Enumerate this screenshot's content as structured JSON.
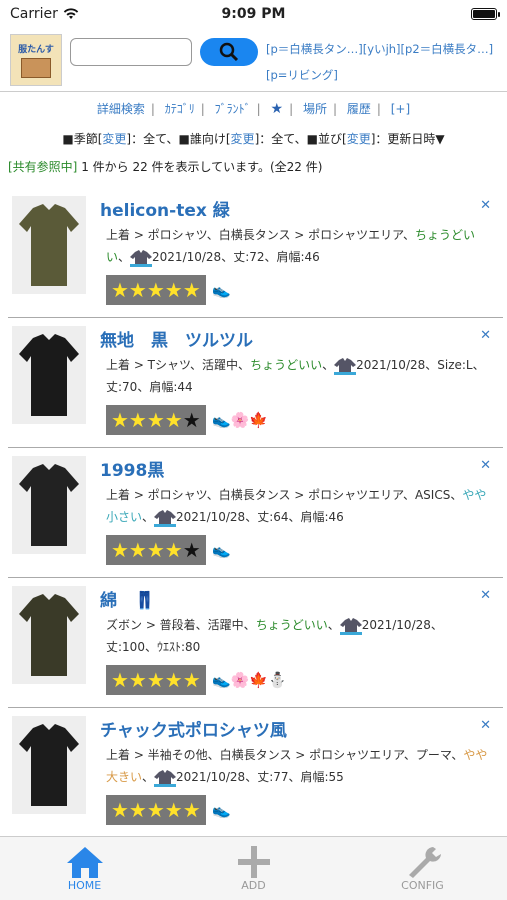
{
  "status": {
    "carrier": "Carrier",
    "time": "9:09 PM"
  },
  "header": {
    "logo_text": "服たんす",
    "search_placeholder": "",
    "query": "[p＝白横長タン…][yいjh][p2＝白横長タ…][p=リビング]"
  },
  "nav": [
    "詳細検索",
    "ｶﾃｺﾞﾘ",
    "ﾌﾞﾗﾝﾄﾞ",
    "★",
    "場所",
    "履歴",
    "[+]"
  ],
  "filters": {
    "season_label": "■季節[",
    "season_link": "変更",
    "season_value": "]：全て、",
    "target_label": "■誰向け[",
    "target_link": "変更",
    "target_value": "]：全て、",
    "sort_label": "■並び[",
    "sort_link": "変更",
    "sort_value": "]：更新日時▼"
  },
  "count": {
    "shared": "[共有参照中]",
    "text": " 1 件から 22 件を表示しています。(全22 件)"
  },
  "items": [
    {
      "title": "helicon-tex 緑",
      "desc_a": "上着 > ポロシャツ、白横長タンス > ポロシャツエリア、",
      "fit": "ちょうどいい",
      "desc_b": "、",
      "date": "2021/10/28、丈:72、肩幅:46",
      "stars_on": "★★★★★",
      "stars_off": "",
      "seasons": "👟",
      "color": "#5a5a38"
    },
    {
      "title": "無地　黒　ツルツル",
      "desc_a": "上着 > Tシャツ、活躍中、",
      "fit": "ちょうどいい",
      "desc_b": "、",
      "date": "2021/10/28、Size:L、丈:70、肩幅:44",
      "stars_on": "★★★★",
      "stars_off": "★",
      "seasons": "👟🌸🍁",
      "color": "#1a1a1a"
    },
    {
      "title": "1998黒",
      "desc_a": "上着 > ポロシャツ、白横長タンス > ポロシャツエリア、ASICS、",
      "small": "やや小さい",
      "desc_b": "、",
      "date": "2021/10/28、丈:64、肩幅:46",
      "stars_on": "★★★★",
      "stars_off": "★",
      "seasons": "👟",
      "color": "#222"
    },
    {
      "title": "綿　👖",
      "desc_a": "ズボン > 普段着、活躍中、",
      "fit": "ちょうどいい",
      "desc_b": "、",
      "date": "2021/10/28、丈:100、ｳｴｽﾄ:80",
      "stars_on": "★★★★★",
      "stars_off": "",
      "seasons": "👟🌸🍁⛄",
      "color": "#3a3a28"
    },
    {
      "title": "チャック式ポロシャツ風",
      "desc_a": "上着 > 半袖その他、白横長タンス > ポロシャツエリア、プーマ、",
      "big": "やや大きい",
      "desc_b": "、",
      "date": "2021/10/28、丈:77、肩幅:55",
      "stars_on": "★★★★★",
      "stars_off": "",
      "seasons": "👟",
      "color": "#1c1c1c"
    }
  ],
  "tabs": [
    {
      "label": "HOME",
      "icon": "home-icon"
    },
    {
      "label": "ADD",
      "icon": "plus-icon"
    },
    {
      "label": "CONFIG",
      "icon": "wrench-icon"
    }
  ],
  "colors": {
    "accent": "#1a86f0",
    "link": "#3a7cc4",
    "green": "#2a8a2a"
  }
}
